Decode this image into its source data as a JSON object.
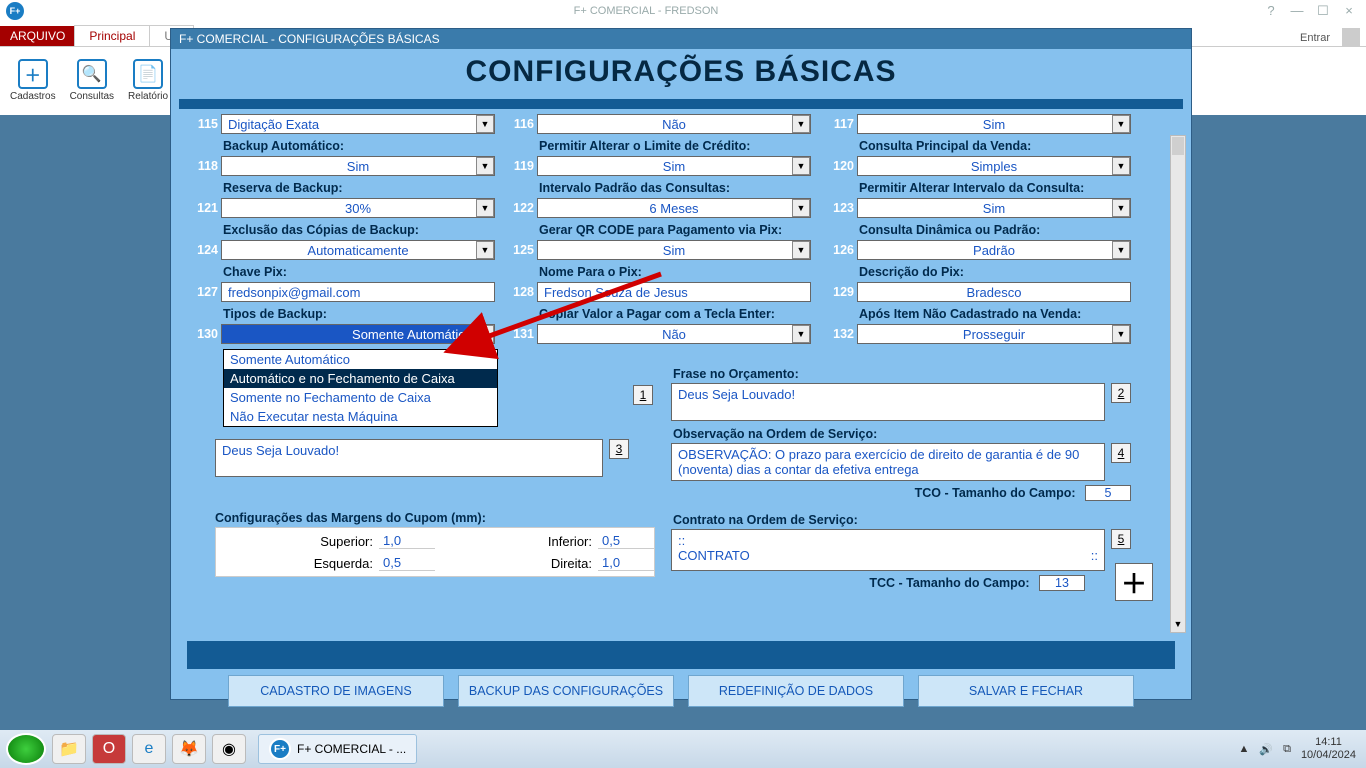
{
  "appWindow": {
    "title": "F+ COMERCIAL - FREDSON",
    "entrar": "Entrar",
    "tabs": {
      "file": "ARQUIVO",
      "principal": "Principal",
      "util": "Uti"
    },
    "ribbon": {
      "cadastros": "Cadastros",
      "consultas": "Consultas",
      "relatorios": "Relatório"
    }
  },
  "dialog": {
    "title": "F+ COMERCIAL - CONFIGURAÇÕES BÁSICAS",
    "heading": "CONFIGURAÇÕES BÁSICAS"
  },
  "fields": {
    "f115": {
      "num": "115",
      "value": "Digitação Exata"
    },
    "f116": {
      "num": "116",
      "value": "Não"
    },
    "f117": {
      "num": "117",
      "value": "Sim"
    },
    "f118": {
      "num": "118",
      "label": "Backup Automático:",
      "value": "Sim"
    },
    "f119": {
      "num": "119",
      "label": "Permitir Alterar o Limite de Crédito:",
      "value": "Sim"
    },
    "f120": {
      "num": "120",
      "label": "Consulta Principal da Venda:",
      "value": "Simples"
    },
    "f121": {
      "num": "121",
      "label": "Reserva de Backup:",
      "value": "30%"
    },
    "f122": {
      "num": "122",
      "label": "Intervalo Padrão das Consultas:",
      "value": "6 Meses"
    },
    "f123": {
      "num": "123",
      "label": "Permitir Alterar Intervalo da Consulta:",
      "value": "Sim"
    },
    "f124": {
      "num": "124",
      "label": "Exclusão das Cópias de Backup:",
      "value": "Automaticamente"
    },
    "f125": {
      "num": "125",
      "label": "Gerar QR CODE para Pagamento via Pix:",
      "value": "Sim"
    },
    "f126": {
      "num": "126",
      "label": "Consulta Dinâmica ou Padrão:",
      "value": "Padrão"
    },
    "f127": {
      "num": "127",
      "label": "Chave Pix:",
      "value": "fredsonpix@gmail.com"
    },
    "f128": {
      "num": "128",
      "label": "Nome Para o Pix:",
      "value": "Fredson Souza de Jesus"
    },
    "f129": {
      "num": "129",
      "label": "Descrição do Pix:",
      "value": "Bradesco"
    },
    "f130": {
      "num": "130",
      "label": "Tipos de Backup:",
      "value": "Somente Automático"
    },
    "f131": {
      "num": "131",
      "label": "Copiar Valor a Pagar com a Tecla Enter:",
      "value": "Não"
    },
    "f132": {
      "num": "132",
      "label": "Após Item Não Cadastrado na Venda:",
      "value": "Prosseguir"
    }
  },
  "dropdown": {
    "opt1": "Somente Automático",
    "opt2": "Automático e no Fechamento de Caixa",
    "opt3": "Somente no Fechamento de Caixa",
    "opt4": "Não Executar nesta Máquina"
  },
  "textblocks": {
    "fraseOrc": {
      "label": "Frase no Orçamento:",
      "value": "Deus Seja Louvado!",
      "btn": "2"
    },
    "obsCupom": {
      "label": "",
      "value": "Deus Seja Louvado!",
      "btn": "3",
      "btnAbove": "1"
    },
    "obsOS": {
      "label": "Observação na Ordem de Serviço:",
      "value": "OBSERVAÇÃO: O prazo para exercício de direito de garantia é de 90 (noventa) dias a contar da efetiva entrega",
      "btn": "4"
    },
    "contrato": {
      "label": "Contrato na Ordem de Serviço:",
      "line1": "::",
      "line2": "CONTRATO",
      "line2r": "::",
      "btn": "5"
    },
    "tco": {
      "label": "TCO - Tamanho do Campo:",
      "value": "5"
    },
    "tcc": {
      "label": "TCC - Tamanho do Campo:",
      "value": "13"
    }
  },
  "margins": {
    "heading": "Configurações das Margens do Cupom (mm):",
    "superior": {
      "k": "Superior:",
      "v": "1,0"
    },
    "inferior": {
      "k": "Inferior:",
      "v": "0,5"
    },
    "esquerda": {
      "k": "Esquerda:",
      "v": "0,5"
    },
    "direita": {
      "k": "Direita:",
      "v": "1,0"
    }
  },
  "buttons": {
    "b1": "CADASTRO DE IMAGENS",
    "b2": "BACKUP DAS CONFIGURAÇÕES",
    "b3": "REDEFINIÇÃO DE DADOS",
    "b4": "SALVAR E FECHAR"
  },
  "taskbar": {
    "running": "F+ COMERCIAL - ...",
    "time": "14:11",
    "date": "10/04/2024"
  }
}
